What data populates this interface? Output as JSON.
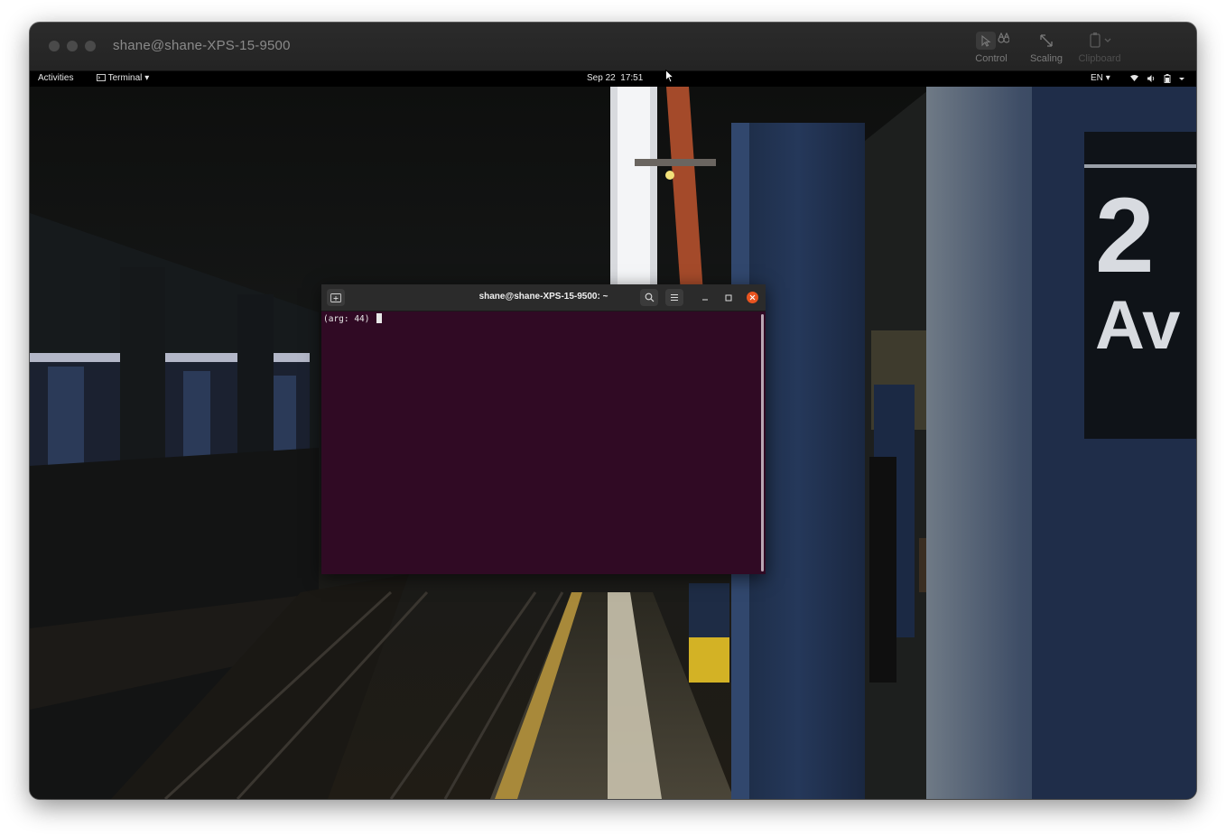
{
  "mac_window": {
    "title": "shane@shane-XPS-15-9500",
    "toolbar": [
      {
        "label": "Control",
        "icon": "control-icon"
      },
      {
        "label": "Scaling",
        "icon": "scaling-icon"
      },
      {
        "label": "Clipboard",
        "icon": "clipboard-icon"
      }
    ]
  },
  "topbar": {
    "activities": "Activities",
    "app_menu": "Terminal",
    "date": "Sep 22",
    "time": "17:51",
    "language": "EN"
  },
  "wallpaper": {
    "station_sign_number": "2",
    "station_sign_text": "Av"
  },
  "terminal": {
    "title": "shane@shane-XPS-15-9500: ~",
    "prompt_text": "(arg: 44) ",
    "background": "#300a24"
  },
  "colors": {
    "close_button": "#e95420"
  }
}
